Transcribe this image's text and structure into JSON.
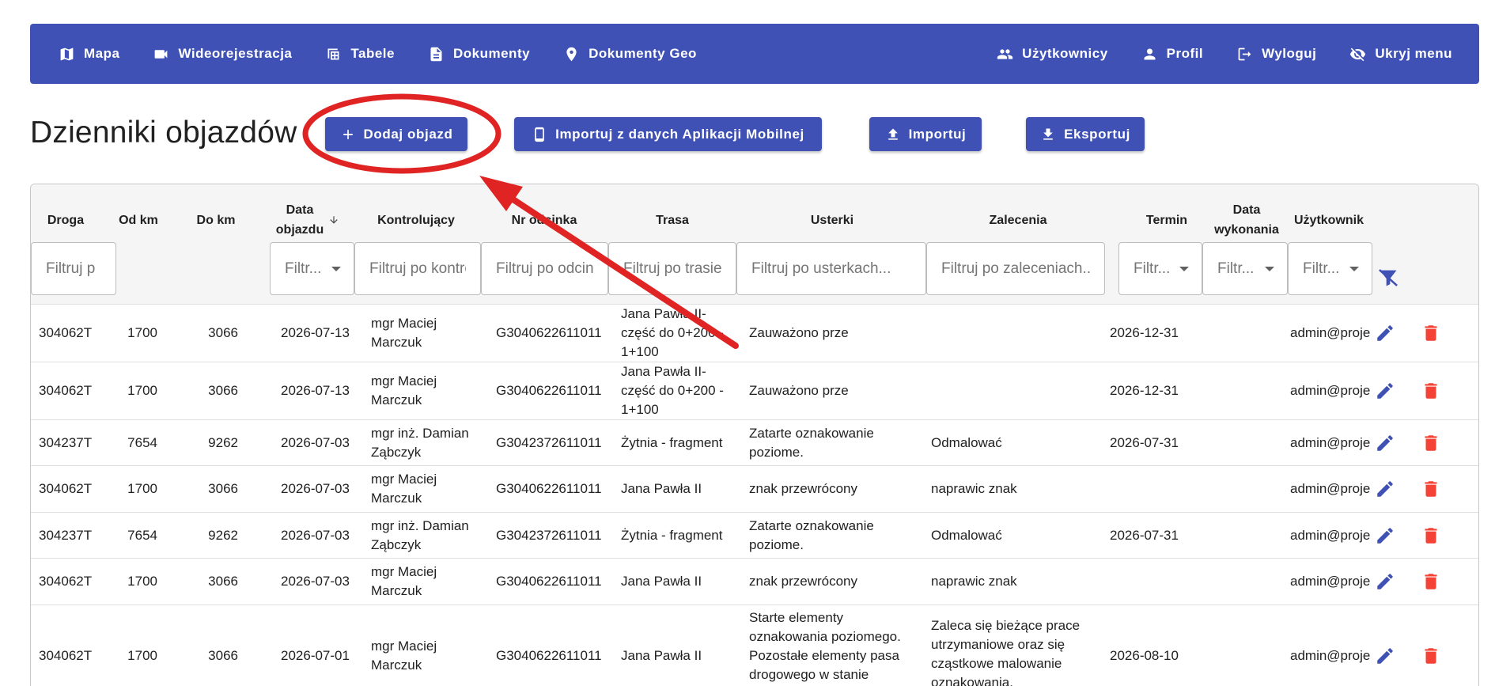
{
  "navbar": {
    "left": [
      {
        "label": "Mapa",
        "icon": "map-icon"
      },
      {
        "label": "Wideorejestracja",
        "icon": "video-camera-icon"
      },
      {
        "label": "Tabele",
        "icon": "table-icon"
      },
      {
        "label": "Dokumenty",
        "icon": "document-icon"
      },
      {
        "label": "Dokumenty Geo",
        "icon": "location-pin-icon"
      }
    ],
    "right": [
      {
        "label": "Użytkownicy",
        "icon": "users-icon"
      },
      {
        "label": "Profil",
        "icon": "person-icon"
      },
      {
        "label": "Wyloguj",
        "icon": "logout-icon"
      },
      {
        "label": "Ukryj menu",
        "icon": "eye-off-icon"
      }
    ]
  },
  "page": {
    "title": "Dzienniki objazdów"
  },
  "toolbar": {
    "add_label": "Dodaj objazd",
    "import_mobile_label": "Importuj z danych Aplikacji Mobilnej",
    "import_label": "Importuj",
    "export_label": "Eksportuj"
  },
  "table": {
    "headers": {
      "droga": "Droga",
      "od_km": "Od km",
      "do_km": "Do km",
      "data_objazdu_1": "Data",
      "data_objazdu_2": "objazdu",
      "kontrolujacy": "Kontrolujący",
      "nr_odcinka": "Nr odcinka",
      "trasa": "Trasa",
      "usterki": "Usterki",
      "zalecenia": "Zalecenia",
      "termin": "Termin",
      "data_wykonania_1": "Data",
      "data_wykonania_2": "wykonania",
      "uzytkownik": "Użytkownik"
    },
    "filters": {
      "droga": "Filtruj p",
      "data_objazdu": "Filtr...",
      "kontrolujacy": "Filtruj po kontrolującym",
      "nr_odcinka": "Filtruj po odcinku",
      "trasa": "Filtruj po trasie",
      "usterki": "Filtruj po usterkach...",
      "zalecenia": "Filtruj po zaleceniach...",
      "termin": "Filtr...",
      "data_wykonania": "Filtr...",
      "uzytkownik": "Filtr..."
    },
    "rows": [
      {
        "droga": "304062T",
        "od_km": "1700",
        "do_km": "3066",
        "data": "2026-07-13",
        "kontrolujacy": "mgr Maciej Marczuk",
        "nr_odcinka": "G3040622611011",
        "trasa": "Jana Pawła II- część do 0+200 - 1+100",
        "usterki": "Zauważono prze",
        "zalecenia": "",
        "termin": "2026-12-31",
        "data_wykonania": "",
        "uzytkownik": "admin@proje"
      },
      {
        "droga": "304062T",
        "od_km": "1700",
        "do_km": "3066",
        "data": "2026-07-13",
        "kontrolujacy": "mgr Maciej Marczuk",
        "nr_odcinka": "G3040622611011",
        "trasa": "Jana Pawła II- część do 0+200 - 1+100",
        "usterki": "Zauważono prze",
        "zalecenia": "",
        "termin": "2026-12-31",
        "data_wykonania": "",
        "uzytkownik": "admin@proje"
      },
      {
        "droga": "304237T",
        "od_km": "7654",
        "do_km": "9262",
        "data": "2026-07-03",
        "kontrolujacy": "mgr inż. Damian Ząbczyk",
        "nr_odcinka": "G3042372611011",
        "trasa": "Żytnia - fragment",
        "usterki": "Zatarte oznakowanie poziome.",
        "zalecenia": "Odmalować",
        "termin": "2026-07-31",
        "data_wykonania": "",
        "uzytkownik": "admin@proje"
      },
      {
        "droga": "304062T",
        "od_km": "1700",
        "do_km": "3066",
        "data": "2026-07-03",
        "kontrolujacy": "mgr Maciej Marczuk",
        "nr_odcinka": "G3040622611011",
        "trasa": "Jana Pawła II",
        "usterki": "znak przewrócony",
        "zalecenia": "naprawic znak",
        "termin": "",
        "data_wykonania": "",
        "uzytkownik": "admin@proje"
      },
      {
        "droga": "304237T",
        "od_km": "7654",
        "do_km": "9262",
        "data": "2026-07-03",
        "kontrolujacy": "mgr inż. Damian Ząbczyk",
        "nr_odcinka": "G3042372611011",
        "trasa": "Żytnia - fragment",
        "usterki": "Zatarte oznakowanie poziome.",
        "zalecenia": "Odmalować",
        "termin": "2026-07-31",
        "data_wykonania": "",
        "uzytkownik": "admin@proje"
      },
      {
        "droga": "304062T",
        "od_km": "1700",
        "do_km": "3066",
        "data": "2026-07-03",
        "kontrolujacy": "mgr Maciej Marczuk",
        "nr_odcinka": "G3040622611011",
        "trasa": "Jana Pawła II",
        "usterki": "znak przewrócony",
        "zalecenia": "naprawic znak",
        "termin": "",
        "data_wykonania": "",
        "uzytkownik": "admin@proje"
      },
      {
        "droga": "304062T",
        "od_km": "1700",
        "do_km": "3066",
        "data": "2026-07-01",
        "kontrolujacy": "mgr Maciej Marczuk",
        "nr_odcinka": "G3040622611011",
        "trasa": "Jana Pawła II",
        "usterki": "Starte elementy oznakowania poziomego. Pozostałe elementy pasa drogowego w stanie zadowalającym.",
        "zalecenia": "Zaleca się bieżące prace utrzymaniowe oraz się cząstkowe malowanie oznakowania.",
        "termin": "2026-08-10",
        "data_wykonania": "",
        "uzytkownik": "admin@proje"
      }
    ]
  },
  "colors": {
    "primary": "#3f51b5",
    "delete": "#f44336",
    "annotation": "#e02424",
    "header_bg": "#f5f5f5"
  }
}
